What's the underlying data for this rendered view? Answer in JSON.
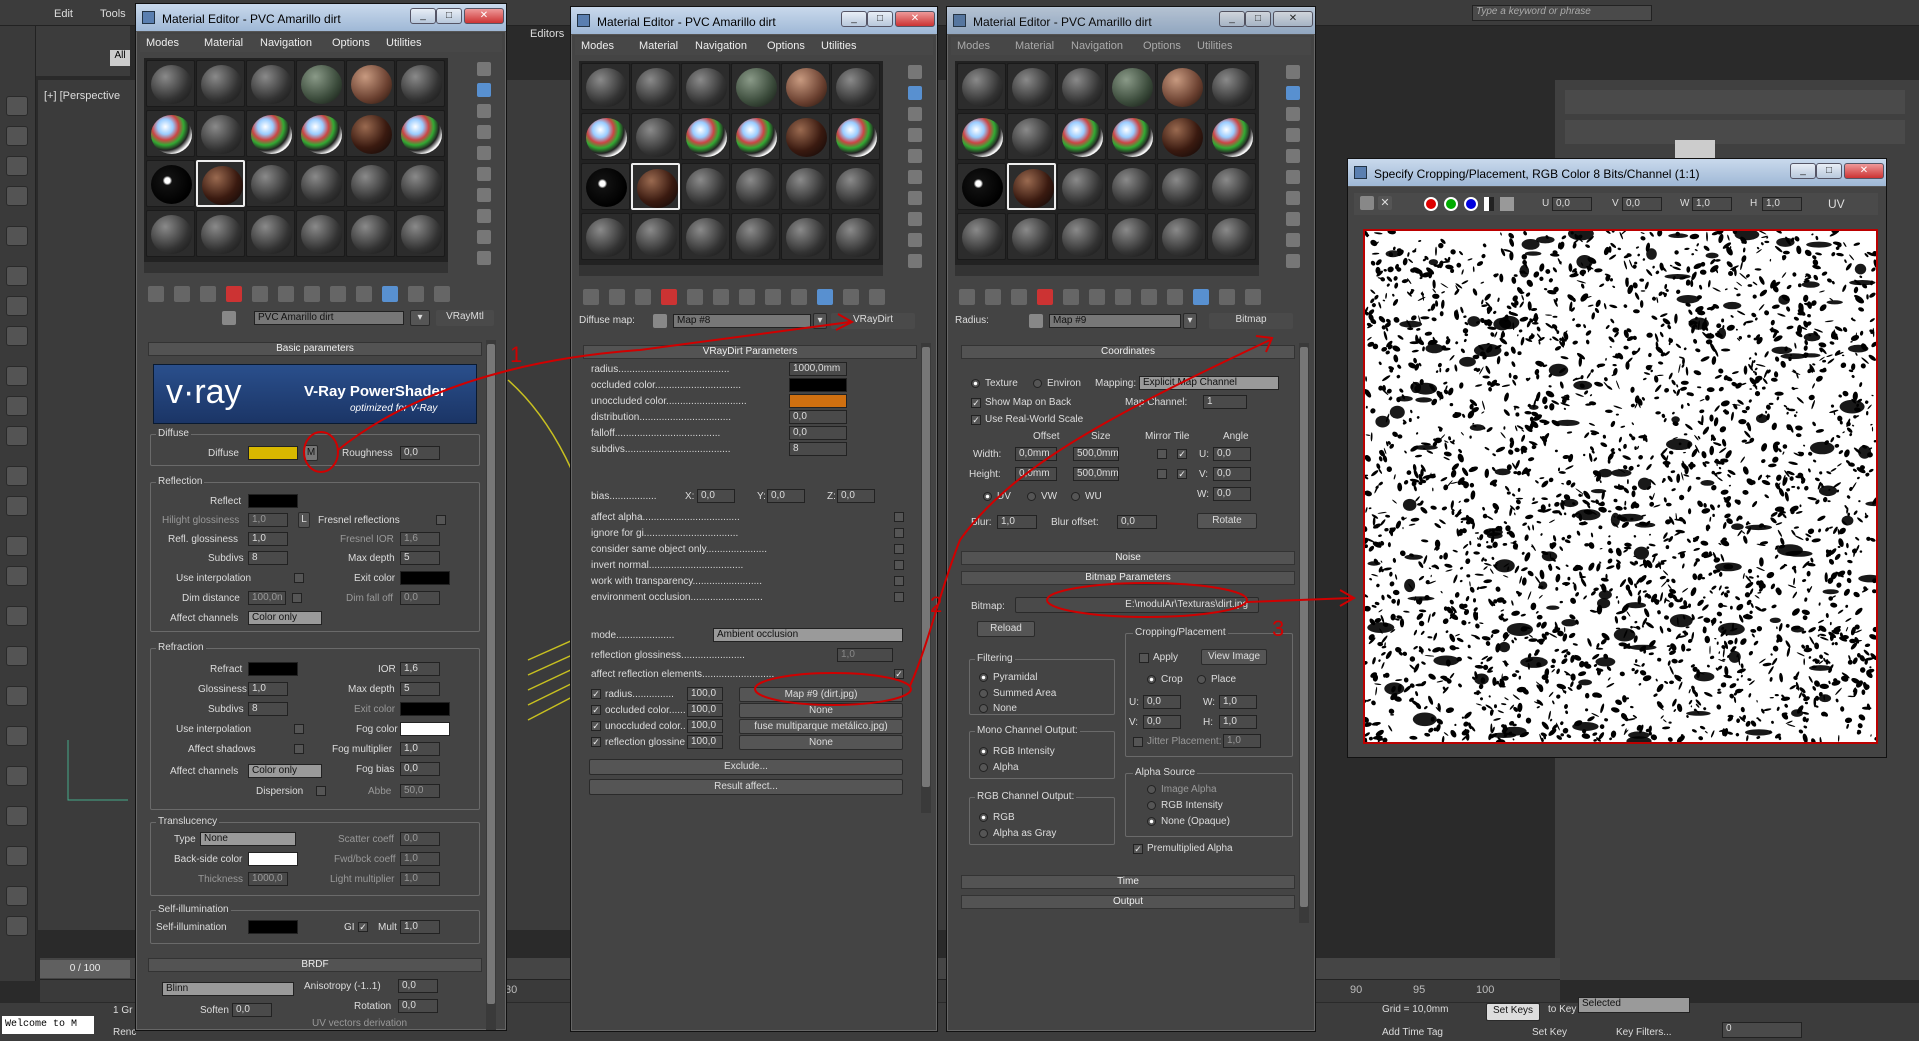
{
  "app": {
    "top_menu": [
      "Edit",
      "Tools"
    ],
    "search_placeholder": "Type a keyword or phrase",
    "viewport_label": "[+] [Perspective",
    "frame_counter": "0 / 100",
    "status_welcome": "Welcome to M",
    "status_render": "Renc",
    "status_grid_prefix": "1 Gr",
    "viewport_tab": "Editors",
    "grid_text": "Grid = 10,0mm",
    "add_time_tag": "Add Time Tag",
    "set_keys": "Set Keys",
    "key_filters": "Key Filters...",
    "selected": "Selected",
    "frame_value": "0",
    "to_key": "to Key",
    "set_key": "Set Key",
    "timeline_ticks": [
      "30",
      "90",
      "95",
      "100"
    ],
    "command_uv": "UV",
    "command_filter_all": "All"
  },
  "editor1": {
    "title": "Material Editor - PVC Amarillo dirt",
    "menus": [
      "Modes",
      "Material",
      "Navigation",
      "Options",
      "Utilities"
    ],
    "name_field": "PVC Amarillo dirt",
    "type_button": "VRayMtl",
    "rollout_basic": "Basic parameters",
    "vray_logo": "v·ray",
    "vray_title": "V-Ray PowerShader",
    "vray_sub": "optimized for V-Ray",
    "diffuse_group": "Diffuse",
    "diffuse_label": "Diffuse",
    "diffuse_map_btn": "M",
    "roughness_label": "Roughness",
    "roughness_value": "0,0",
    "reflection_group": "Reflection",
    "reflect_label": "Reflect",
    "hilight_label": "Hilight glossiness",
    "hilight_value": "1,0",
    "lock_label": "L",
    "fresnel_label": "Fresnel reflections",
    "refl_gloss_label": "Refl. glossiness",
    "refl_gloss_value": "1,0",
    "fresnel_ior_label": "Fresnel IOR",
    "fresnel_ior_value": "1,6",
    "subdivs_label": "Subdivs",
    "subdivs_value": "8",
    "max_depth_label": "Max depth",
    "max_depth_value": "5",
    "use_interp_label": "Use interpolation",
    "exit_color_label": "Exit color",
    "dim_distance_label": "Dim distance",
    "dim_distance_value": "100,0n",
    "dim_falloff_label": "Dim fall off",
    "dim_falloff_value": "0,0",
    "affect_channels_label": "Affect channels",
    "affect_channels_value": "Color only",
    "refraction_group": "Refraction",
    "refract_label": "Refract",
    "ior_label": "IOR",
    "ior_value": "1,6",
    "glossiness_label": "Glossiness",
    "glossiness_value": "1,0",
    "r_max_depth_value": "5",
    "r_subdivs_value": "8",
    "r_exit_color_label": "Exit color",
    "r_use_interp_label": "Use interpolation",
    "fog_color_label": "Fog color",
    "affect_shadows_label": "Affect shadows",
    "fog_mult_label": "Fog multiplier",
    "fog_mult_value": "1,0",
    "r_affect_channels_value": "Color only",
    "fog_bias_label": "Fog bias",
    "fog_bias_value": "0,0",
    "dispersion_label": "Dispersion",
    "abbe_label": "Abbe",
    "abbe_value": "50,0",
    "translucency_group": "Translucency",
    "type_label": "Type",
    "type_value": "None",
    "scatter_label": "Scatter coeff",
    "scatter_value": "0,0",
    "backside_label": "Back-side color",
    "fwd_bck_label": "Fwd/bck coeff",
    "fwd_bck_value": "1,0",
    "thickness_label": "Thickness",
    "thickness_value": "1000,0",
    "light_mult_label": "Light multiplier",
    "light_mult_value": "1,0",
    "selfillum_group": "Self-illumination",
    "selfillum_label": "Self-illumination",
    "gi_label": "GI",
    "mult_label": "Mult",
    "mult_value": "1,0",
    "brdf_hdr": "BRDF",
    "brdf_type": "Blinn",
    "anisotropy_label": "Anisotropy (-1..1)",
    "anisotropy_value": "0,0",
    "rotation_label": "Rotation",
    "rotation_value": "0,0",
    "soften_label": "Soften",
    "soften_value": "0,0",
    "uv_vectors_label": "UV vectors derivation"
  },
  "editor2": {
    "title": "Material Editor - PVC Amarillo dirt",
    "menus": [
      "Modes",
      "Material",
      "Navigation",
      "Options",
      "Utilities"
    ],
    "slot_label": "Diffuse map:",
    "name_field": "Map #8",
    "type_button": "VRayDirt",
    "rollout": "VRayDirt Parameters",
    "params": [
      {
        "label": "radius........................................",
        "value": "1000,0mm"
      },
      {
        "label": "occluded color...............................",
        "value": ""
      },
      {
        "label": "unoccluded color.............................",
        "value": ""
      },
      {
        "label": "distribution.................................",
        "value": "0,0"
      },
      {
        "label": "falloff......................................",
        "value": "0,0"
      },
      {
        "label": "subdivs......................................",
        "value": "8"
      }
    ],
    "bias_label": "bias.................",
    "bias_x_label": "X:",
    "bias_x": "0,0",
    "bias_y_label": "Y:",
    "bias_y": "0,0",
    "bias_z_label": "Z:",
    "bias_z": "0,0",
    "checks": [
      "affect alpha...................................",
      "ignore for gi..................................",
      "consider same object only......................",
      "invert normal..................................",
      "work with transparency.........................",
      "environment occlusion.........................."
    ],
    "mode_label": "mode.....................",
    "mode_value": "Ambient occlusion",
    "refl_gloss_label": "reflection glossiness.......................",
    "refl_gloss_value": "1,0",
    "affect_refl_label": "affect reflection elements..........................",
    "maps": [
      {
        "label": "radius...............",
        "amount": "100,0",
        "map": "Map #9 (dirt.jpg)"
      },
      {
        "label": "occluded color..........",
        "amount": "100,0",
        "map": "None"
      },
      {
        "label": "unoccluded color........",
        "amount": "100,0",
        "map": "fuse multiparque metálico.jpg)"
      },
      {
        "label": "reflection glossiness",
        "amount": "100,0",
        "map": "None"
      }
    ],
    "exclude_btn": "Exclude...",
    "result_affect_btn": "Result affect..."
  },
  "editor3": {
    "title": "Material Editor - PVC Amarillo dirt",
    "menus": [
      "Modes",
      "Material",
      "Navigation",
      "Options",
      "Utilities"
    ],
    "slot_label": "Radius:",
    "name_field": "Map #9",
    "type_button": "Bitmap",
    "coords_hdr": "Coordinates",
    "texture_label": "Texture",
    "environ_label": "Environ",
    "mapping_label": "Mapping:",
    "mapping_value": "Explicit Map Channel",
    "show_map_label": "Show Map on Back",
    "map_channel_label": "Map Channel:",
    "map_channel_value": "1",
    "real_world_label": "Use Real-World Scale",
    "offset_label": "Offset",
    "size_label": "Size",
    "mirror_tile_label": "Mirror Tile",
    "angle_label": "Angle",
    "width_label": "Width:",
    "width_offset": "0,0mm",
    "width_size": "500,0mm",
    "u_label": "U:",
    "u_angle": "0,0",
    "height_label": "Height:",
    "height_offset": "0,0mm",
    "height_size": "500,0mm",
    "v_label": "V:",
    "v_angle": "0,0",
    "uv_label": "UV",
    "vw_label": "VW",
    "wu_label": "WU",
    "w_label": "W:",
    "w_angle": "0,0",
    "blur_label": "Blur:",
    "blur_value": "1,0",
    "blur_offset_label": "Blur offset:",
    "blur_offset_value": "0,0",
    "rotate_btn": "Rotate",
    "noise_hdr": "Noise",
    "bitmap_params_hdr": "Bitmap Parameters",
    "bitmap_label": "Bitmap:",
    "bitmap_path": "E:\\modulAr\\Texturas\\dirt.jpg",
    "reload_btn": "Reload",
    "cropping_group": "Cropping/Placement",
    "apply_label": "Apply",
    "view_image_btn": "View Image",
    "crop_label": "Crop",
    "place_label": "Place",
    "filtering_group": "Filtering",
    "pyramidal_label": "Pyramidal",
    "summed_label": "Summed Area",
    "none_label": "None",
    "cu_label": "U:",
    "cu_value": "0,0",
    "cw_label": "W:",
    "cw_value": "1,0",
    "cv_label": "V:",
    "cv_value": "0,0",
    "ch_label": "H:",
    "ch_value": "1,0",
    "jitter_label": "Jitter Placement:",
    "jitter_value": "1,0",
    "mono_group": "Mono Channel Output:",
    "rgb_intensity_label": "RGB Intensity",
    "alpha_label": "Alpha",
    "alpha_source_group": "Alpha Source",
    "image_alpha_label": "Image Alpha",
    "as_rgb_intensity_label": "RGB Intensity",
    "none_opaque_label": "None (Opaque)",
    "rgb_group": "RGB Channel Output:",
    "rgb_label": "RGB",
    "alpha_gray_label": "Alpha as Gray",
    "premult_label": "Premultiplied Alpha",
    "time_hdr": "Time",
    "output_hdr": "Output"
  },
  "crop_window": {
    "title": "Specify Cropping/Placement, RGB Color 8 Bits/Channel (1:1)",
    "u_label": "U",
    "u_value": "0,0",
    "v_label": "V",
    "v_value": "0,0",
    "w_label": "W",
    "w_value": "1,0",
    "h_label": "H",
    "h_value": "1,0",
    "uv_label": "UV"
  },
  "annotations": {
    "label_1": "1",
    "label_2": "2",
    "label_3": "3",
    "color": "#d00000"
  },
  "colors": {
    "diffuse_swatch": "#d8b800",
    "unoccluded_swatch": "#d07010",
    "title_bar": "#b6cbe4"
  }
}
